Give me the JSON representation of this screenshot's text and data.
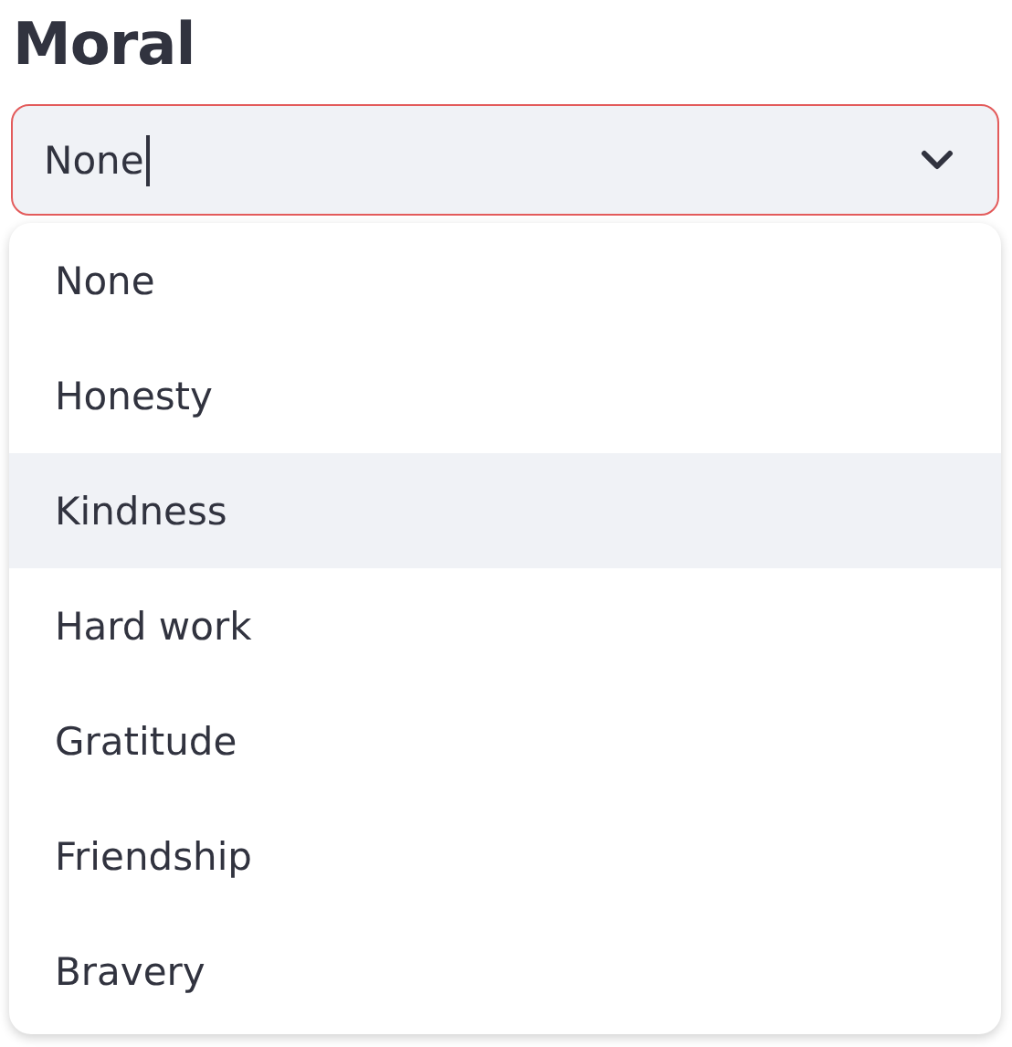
{
  "label": "Moral",
  "select": {
    "value": "None",
    "focused": true,
    "expanded": true
  },
  "options": [
    {
      "label": "None",
      "highlighted": false
    },
    {
      "label": "Honesty",
      "highlighted": false
    },
    {
      "label": "Kindness",
      "highlighted": true
    },
    {
      "label": "Hard work",
      "highlighted": false
    },
    {
      "label": "Gratitude",
      "highlighted": false
    },
    {
      "label": "Friendship",
      "highlighted": false
    },
    {
      "label": "Bravery",
      "highlighted": false
    }
  ]
}
